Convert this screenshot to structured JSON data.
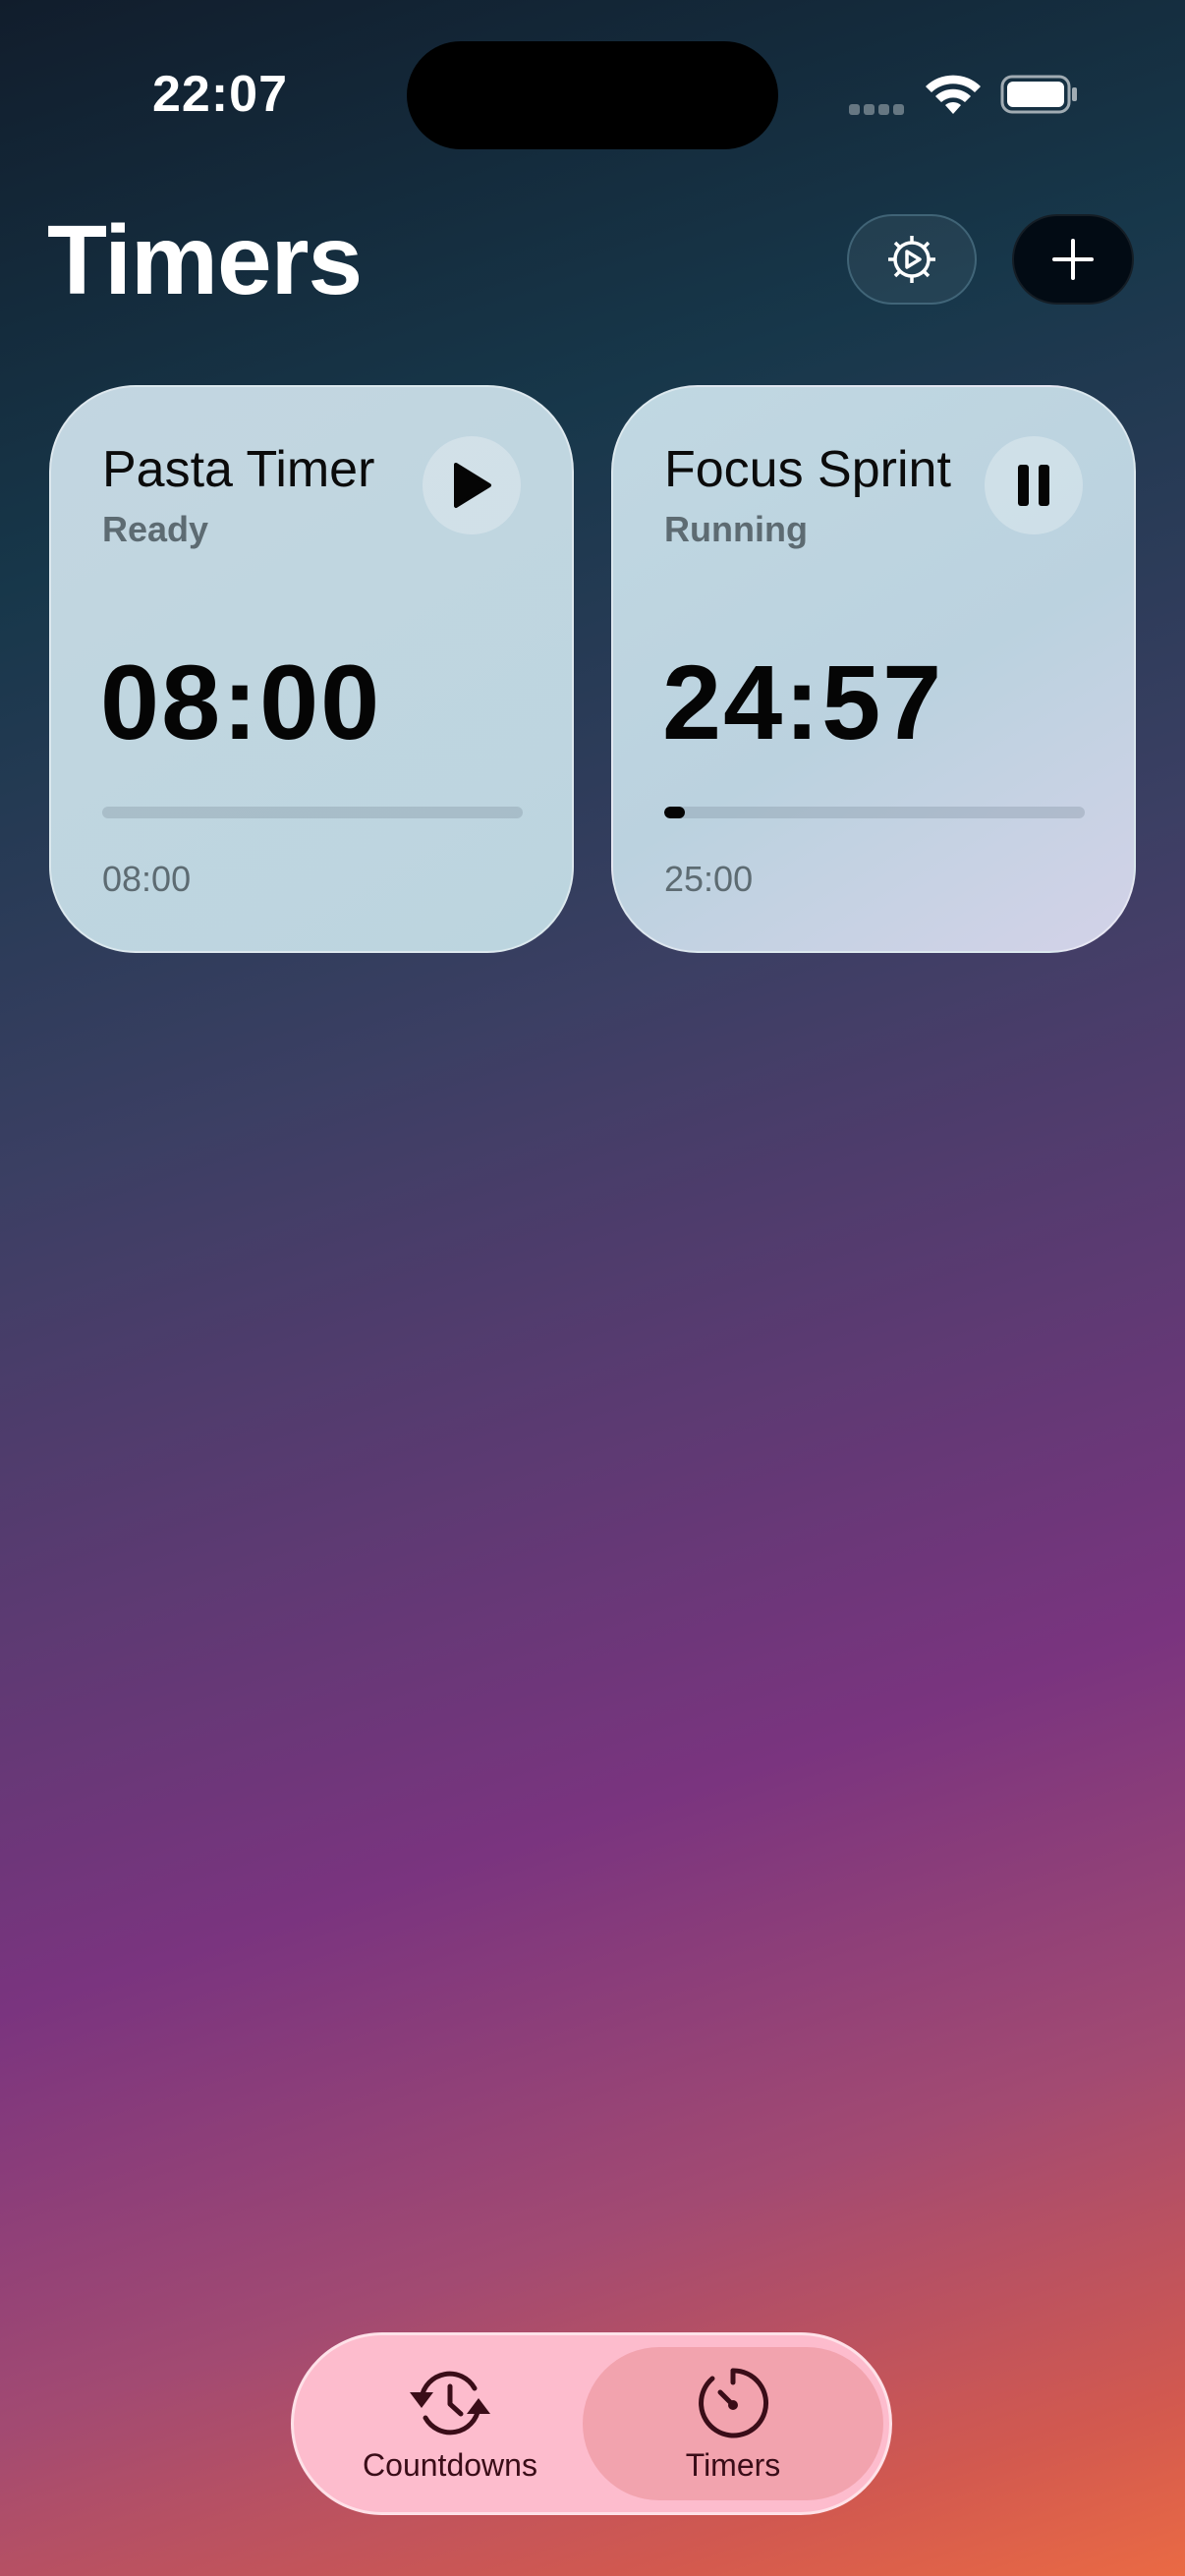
{
  "status_bar": {
    "time": "22:07"
  },
  "header": {
    "title": "Timers",
    "settings_icon": "gear-play-icon",
    "add_icon": "plus-icon"
  },
  "timers": [
    {
      "name": "Pasta Timer",
      "status": "Ready",
      "remaining": "08:00",
      "total": "08:00",
      "progress": 0,
      "action_icon": "play-icon"
    },
    {
      "name": "Focus Sprint",
      "status": "Running",
      "remaining": "24:57",
      "total": "25:00",
      "progress": 0.05,
      "action_icon": "pause-icon"
    }
  ],
  "tabbar": {
    "tabs": [
      {
        "label": "Countdowns",
        "icon": "clock-arrows-icon",
        "selected": false
      },
      {
        "label": "Timers",
        "icon": "timer-icon",
        "selected": true
      }
    ]
  },
  "colors": {
    "tab_background": "#fdbccd",
    "tab_selected": "#f2a3ae",
    "tab_text": "#3a0d18"
  }
}
